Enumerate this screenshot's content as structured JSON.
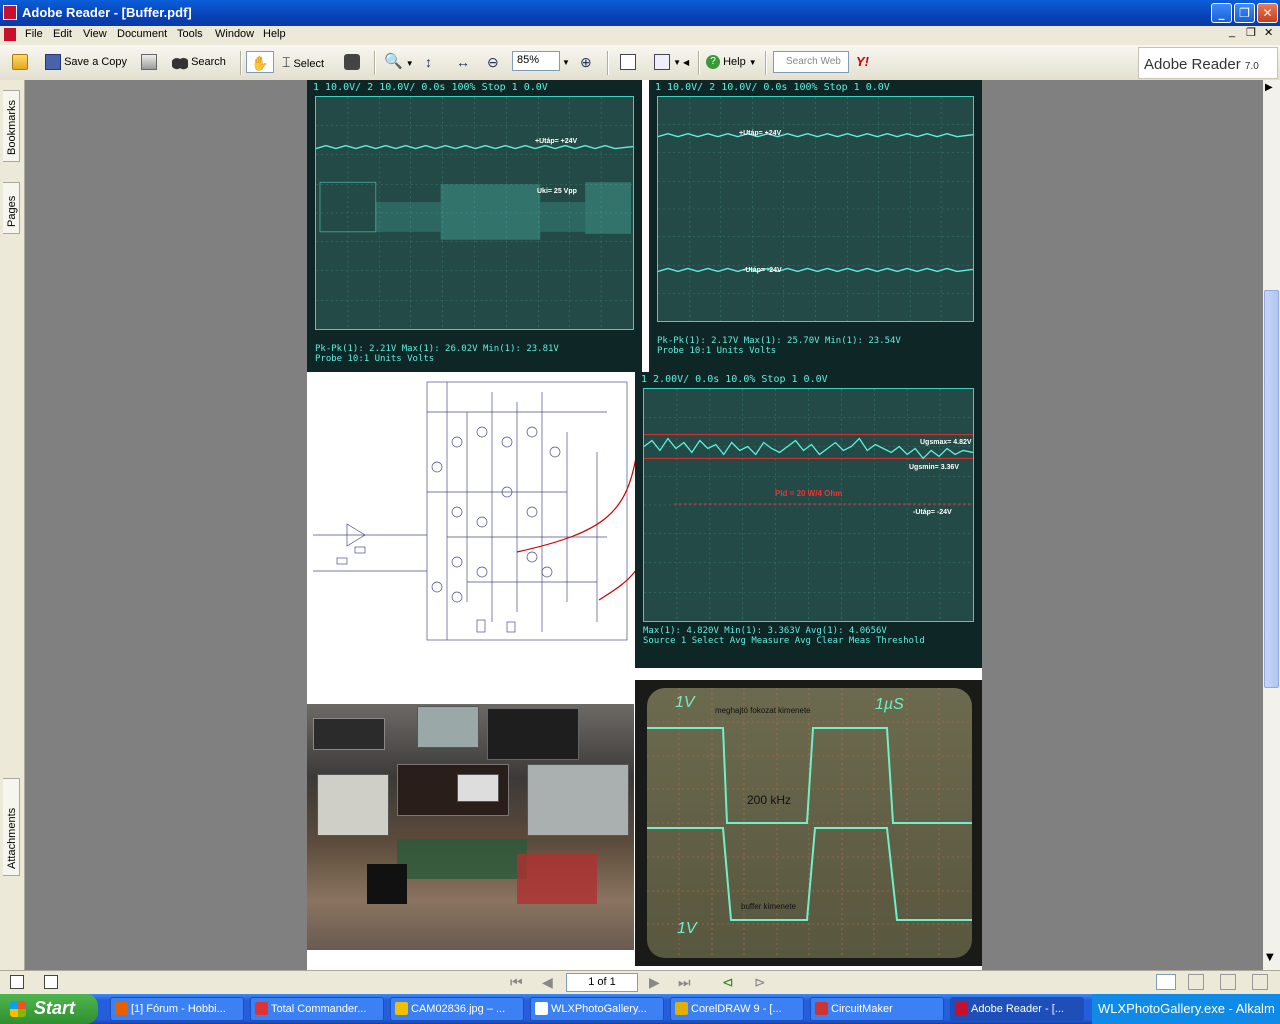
{
  "window": {
    "title": "Adobe Reader - [Buffer.pdf]"
  },
  "menu": [
    "File",
    "Edit",
    "View",
    "Document",
    "Tools",
    "Window",
    "Help"
  ],
  "toolbar": {
    "save_copy": "Save a Copy",
    "search": "Search",
    "select": "Select",
    "zoom_value": "85%",
    "help": "Help",
    "search_web_placeholder": "Search Web",
    "brand": "Adobe Reader",
    "brand_version": "7.0"
  },
  "nav_tabs": [
    "Bookmarks",
    "Pages",
    "Attachments"
  ],
  "status": {
    "page_display": "1 of 1"
  },
  "document": {
    "scope1": {
      "top": "1 10.0V/  2 10.0V/      0.0s   100%   Stop  1   0.0V",
      "label_top": "+Utáp= +24V",
      "label_mid": "Uki= 25 Vpp",
      "bottom_meas": "Pk-Pk(1): 2.21V     Max(1): 26.02V     Min(1): 23.81V",
      "bottom_btns": "Probe 10:1    Units Volts"
    },
    "scope2": {
      "top": "1 10.0V/  2 10.0V/      0.0s   100%   Stop  1   0.0V",
      "label_top": "+Utáp= +24V",
      "label_bot": "-Utáp= -24V",
      "bottom_meas": "Pk-Pk(1): 2.17V     Max(1): 25.70V     Min(1): 23.54V",
      "bottom_btns": "Probe 10:1    Units Volts"
    },
    "scope3": {
      "top": "1 2.00V/             0.0s   10.0%   Stop  1   0.0V",
      "label_max": "Ugsmax= 4.82V",
      "label_min": "Ugsmin= 3.36V",
      "label_pld": "Pld = 20 W/4 Ohm",
      "label_neg": "-Utáp= -24V",
      "bottom_meas": "Max(1): 4.820V    Min(1): 3.363V    Avg(1): 4.0656V",
      "bottom_btns": "Source 1   Select Avg   Measure Avg   Clear Meas   Threshold"
    },
    "scope4": {
      "ch_top": "1V",
      "time": "1µS",
      "label_top": "meghajtó fokozat kimenete",
      "label_freq": "200 kHz",
      "label_bot": "buffer kimenete",
      "ch_bot": "1V"
    }
  },
  "taskbar": {
    "start": "Start",
    "tasks": [
      {
        "label": "[1] Fórum - Hobbi...",
        "color": "#e66000"
      },
      {
        "label": "Total Commander...",
        "color": "#d33"
      },
      {
        "label": "CAM02836.jpg – ...",
        "color": "#f0c000"
      },
      {
        "label": "WLXPhotoGallery...",
        "color": "#ffffff"
      },
      {
        "label": "CorelDRAW 9 - [...",
        "color": "#e0b000"
      },
      {
        "label": "CircuitMaker",
        "color": "#c33"
      },
      {
        "label": "Adobe Reader - [...",
        "color": "#c8102e"
      }
    ],
    "tray": "WLXPhotoGallery.exe - Alkalm"
  }
}
